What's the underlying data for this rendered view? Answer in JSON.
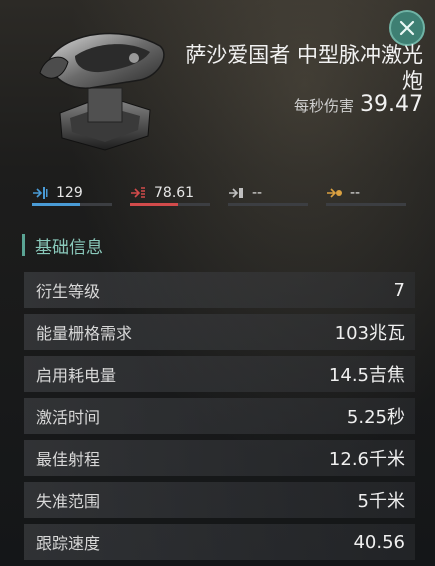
{
  "header": {
    "title": "萨沙爱国者 中型脉冲激光炮",
    "dps_label": "每秒伤害",
    "dps_value": "39.47"
  },
  "damage_types": [
    {
      "value": "129",
      "icon": "em-damage-icon",
      "color": "#4a9bd6",
      "fill": 0.6
    },
    {
      "value": "78.61",
      "icon": "thermal-damage-icon",
      "color": "#d24b4b",
      "fill": 0.6
    },
    {
      "value": "--",
      "icon": "kinetic-damage-icon",
      "color": "#bfbfbf",
      "fill": 0
    },
    {
      "value": "--",
      "icon": "explosive-damage-icon",
      "color": "#d9a041",
      "fill": 0
    }
  ],
  "section": {
    "title": "基础信息"
  },
  "stats": [
    {
      "label": "衍生等级",
      "value": "7"
    },
    {
      "label": "能量栅格需求",
      "value": "103兆瓦"
    },
    {
      "label": "启用耗电量",
      "value": "14.5吉焦"
    },
    {
      "label": "激活时间",
      "value": "5.25秒"
    },
    {
      "label": "最佳射程",
      "value": "12.6千米"
    },
    {
      "label": "失准范围",
      "value": "5千米"
    },
    {
      "label": "跟踪速度",
      "value": "40.56"
    }
  ],
  "colors": {
    "accent": "#5aa494",
    "close_bg": "#3e7f73"
  }
}
